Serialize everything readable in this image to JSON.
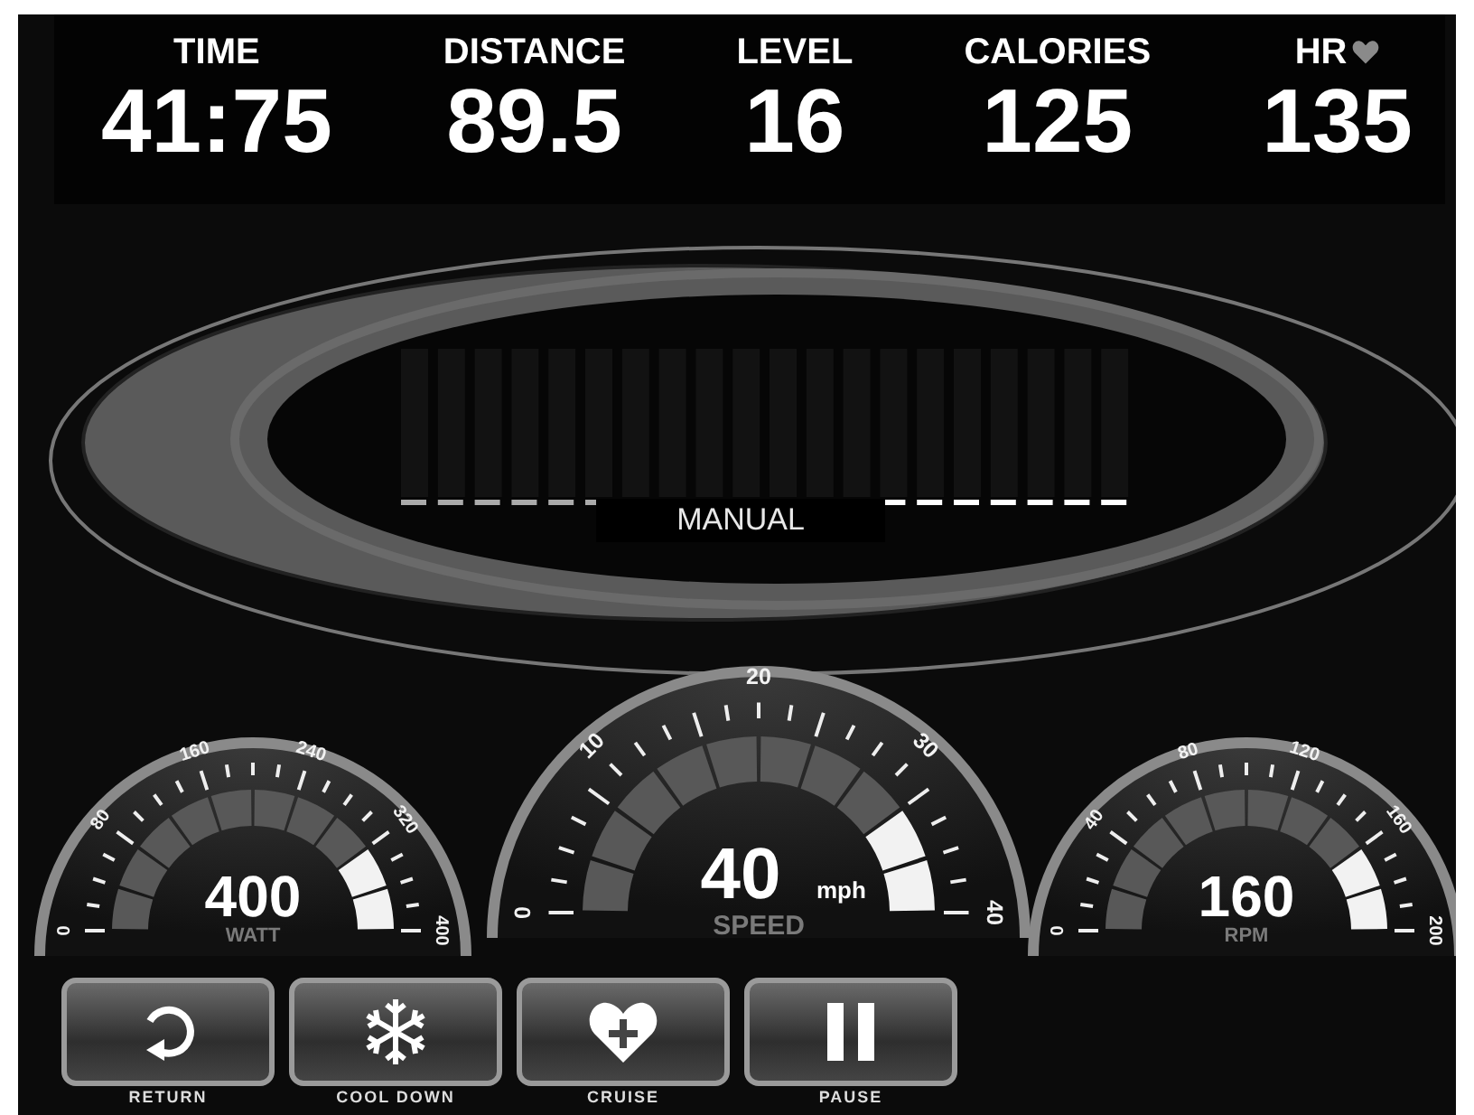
{
  "stats": [
    {
      "kind": "plain",
      "label": "TIME",
      "value": "41:75"
    },
    {
      "kind": "plain",
      "label": "DISTANCE",
      "value": "89.5"
    },
    {
      "kind": "plain",
      "label": "LEVEL",
      "value": "16"
    },
    {
      "kind": "plain",
      "label": "CALORIES",
      "value": "125"
    },
    {
      "kind": "heart",
      "label": "HR",
      "value": "135"
    }
  ],
  "program": {
    "name": "MANUAL"
  },
  "gauges": [
    {
      "label": "WATT",
      "value": "400",
      "level": 1,
      "ticks": [
        "0",
        "80",
        "160",
        "240",
        "320",
        "400"
      ]
    },
    {
      "label": "SPEED",
      "value": "40",
      "unit": "mph",
      "level": 1,
      "ticks": [
        "0",
        "10",
        "20",
        "30",
        "40"
      ]
    },
    {
      "label": "RPM",
      "value": "160",
      "level": 1,
      "ticks": [
        "0",
        "40",
        "80",
        "120",
        "160",
        "200"
      ]
    }
  ],
  "buttons": [
    {
      "kind": "return",
      "label": "RETURN"
    },
    {
      "kind": "cooldown",
      "label": "COOL DOWN"
    },
    {
      "kind": "cruise",
      "label": "CRUISE"
    },
    {
      "kind": "pause",
      "label": "PAUSE"
    }
  ]
}
